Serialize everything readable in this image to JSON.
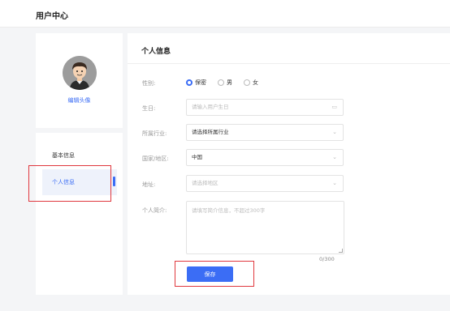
{
  "header": {
    "title": "用户中心"
  },
  "profile_card": {
    "edit_avatar_label": "编辑头像"
  },
  "sidebar": {
    "items": [
      {
        "label": "基本信息",
        "active": false
      },
      {
        "label": "个人信息",
        "active": true
      }
    ]
  },
  "main": {
    "section_title": "个人信息",
    "gender": {
      "label": "性别:",
      "options": [
        {
          "label": "保密",
          "checked": true
        },
        {
          "label": "男",
          "checked": false
        },
        {
          "label": "女",
          "checked": false
        }
      ]
    },
    "birthday": {
      "label": "生日:",
      "placeholder": "请输入用户生日",
      "icon": "calendar-icon"
    },
    "industry": {
      "label": "所属行业:",
      "value": "请选择所属行业",
      "icon": "chevron-down-icon"
    },
    "country": {
      "label": "国家/地区:",
      "value": "中国",
      "icon": "chevron-down-icon"
    },
    "address": {
      "label": "地址:",
      "placeholder": "请选择地区",
      "icon": "chevron-down-icon"
    },
    "bio": {
      "label": "个人简介:",
      "placeholder": "请填写简介信息，不超过300字",
      "counter": "0/300"
    },
    "save_label": "保存"
  },
  "colors": {
    "accent": "#3b6df5",
    "highlight_box": "#e0383e"
  }
}
